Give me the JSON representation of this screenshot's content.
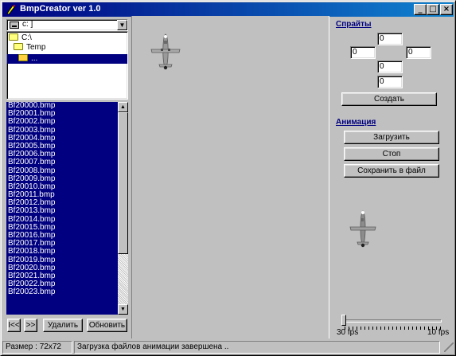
{
  "window": {
    "title": "BmpCreator ver 1.0",
    "controls": {
      "minimize": "_",
      "maximize": "□",
      "close": "×"
    }
  },
  "left_panel": {
    "drive": "c: ]",
    "directories": [
      "C:\\",
      "Temp",
      "..."
    ],
    "selected_directory_index": 2,
    "files": [
      "Bf20000.bmp",
      "Bf20001.bmp",
      "Bf20002.bmp",
      "Bf20003.bmp",
      "Bf20004.bmp",
      "Bf20005.bmp",
      "Bf20006.bmp",
      "Bf20007.bmp",
      "Bf20008.bmp",
      "Bf20009.bmp",
      "Bf20010.bmp",
      "Bf20011.bmp",
      "Bf20012.bmp",
      "Bf20013.bmp",
      "Bf20014.bmp",
      "Bf20015.bmp",
      "Bf20016.bmp",
      "Bf20017.bmp",
      "Bf20018.bmp",
      "Bf20019.bmp",
      "Bf20020.bmp",
      "Bf20021.bmp",
      "Bf20022.bmp",
      "Bf20023.bmp"
    ],
    "buttons": {
      "select_all": "I<<",
      "deselect": ">>",
      "delete": "Удалить",
      "refresh": "Обновить"
    }
  },
  "right_panel": {
    "sprites_title": "Спрайты",
    "sprite_fields": {
      "top": "0",
      "left": "0",
      "right": "0",
      "middle": "0",
      "bottom": "0"
    },
    "create_button": "Создать",
    "animation_title": "Анимация",
    "load_button": "Загрузить",
    "stop_button": "Стоп",
    "save_button": "Сохранить в файл",
    "fps_min_label": "30 fps",
    "fps_max_label": "10 fps"
  },
  "statusbar": {
    "size_label": "Размер : 72x72",
    "message": "Загрузка файлов анимации завершена .."
  },
  "colors": {
    "title_gradient_start": "#000080",
    "title_gradient_end": "#1084d0",
    "selection": "#000080",
    "face": "#c0c0c0"
  }
}
